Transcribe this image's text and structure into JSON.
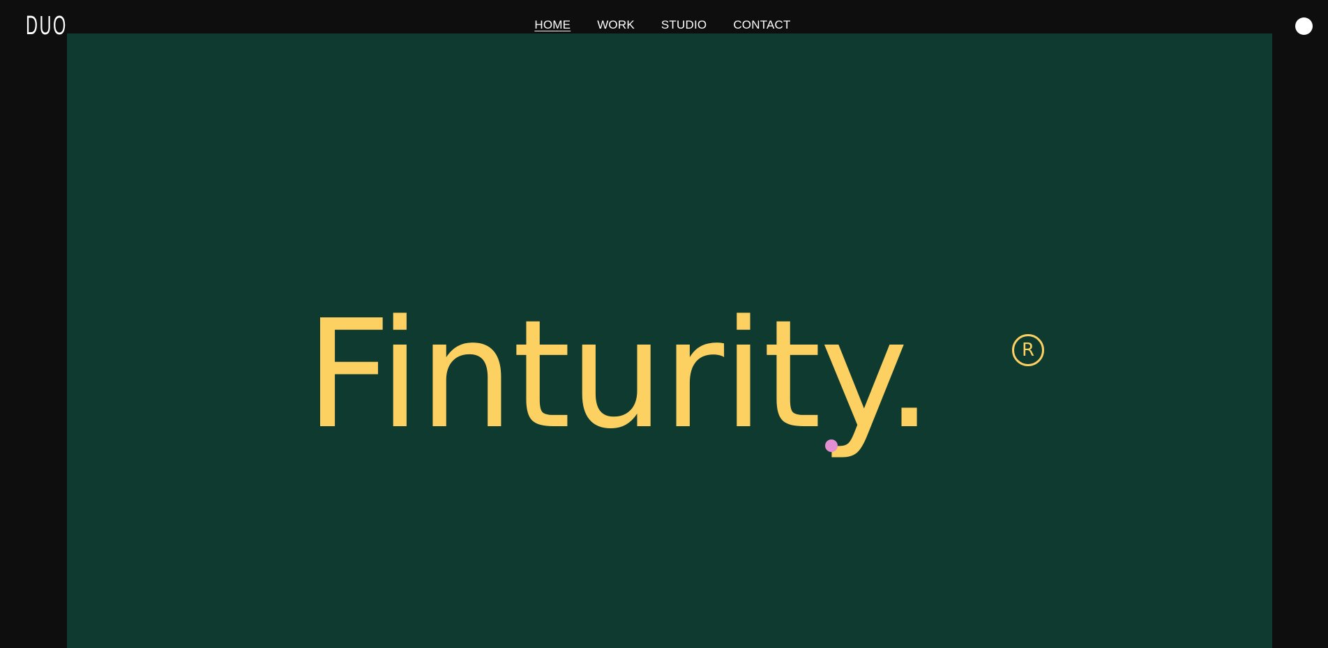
{
  "header": {
    "logo_text": "DUO",
    "nav": [
      {
        "label": "HOME",
        "active": true
      },
      {
        "label": "WORK",
        "active": false
      },
      {
        "label": "STUDIO",
        "active": false
      },
      {
        "label": "CONTACT",
        "active": false
      }
    ],
    "menu_icon": "circle-menu-icon"
  },
  "hero": {
    "brand_wordmark": "Finturity.",
    "registered_mark": "R",
    "background_color": "#0e3a2f",
    "wordmark_color": "#fdd062"
  },
  "cursor": {
    "icon": "cursor-dot-icon",
    "color": "#e48fd4"
  },
  "colors": {
    "page_background": "#0f0e0f",
    "nav_text": "#ffffff"
  }
}
